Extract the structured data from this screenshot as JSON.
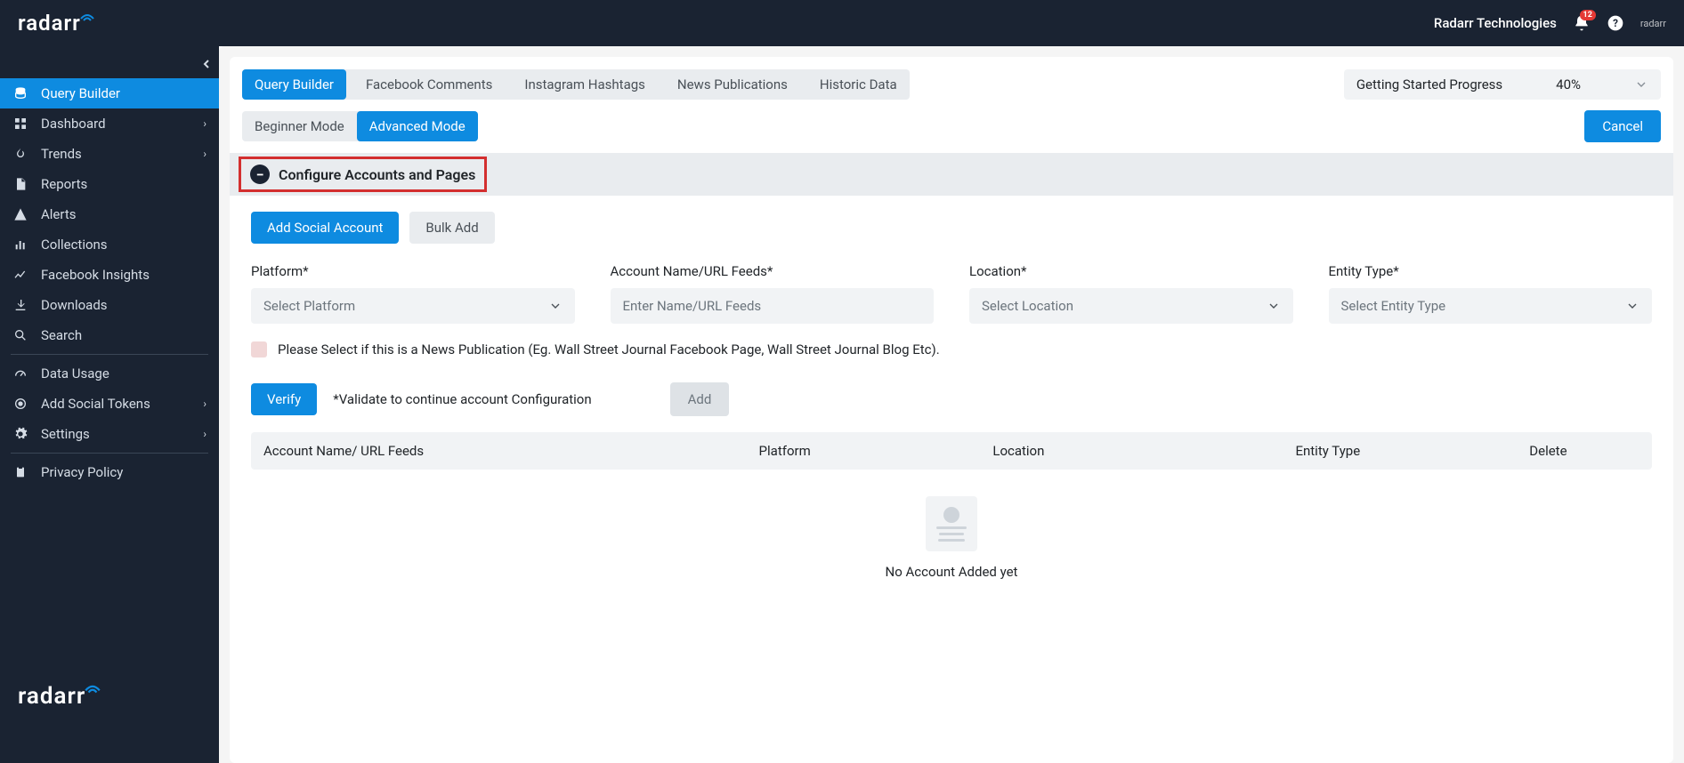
{
  "header": {
    "logo": "radarr",
    "company": "Radarr Technologies",
    "notifications": "12"
  },
  "sidebar": {
    "items": [
      {
        "label": "Query Builder",
        "icon": "db",
        "active": true
      },
      {
        "label": "Dashboard",
        "icon": "grid",
        "chevron": true
      },
      {
        "label": "Trends",
        "icon": "flame",
        "chevron": true
      },
      {
        "label": "Reports",
        "icon": "file"
      },
      {
        "label": "Alerts",
        "icon": "warn"
      },
      {
        "label": "Collections",
        "icon": "bars"
      },
      {
        "label": "Facebook Insights",
        "icon": "chart"
      },
      {
        "label": "Downloads",
        "icon": "download"
      },
      {
        "label": "Search",
        "icon": "search"
      },
      {
        "label": "Data Usage",
        "icon": "gauge",
        "divider_before": true
      },
      {
        "label": "Add Social Tokens",
        "icon": "target",
        "chevron": true
      },
      {
        "label": "Settings",
        "icon": "gear",
        "chevron": true
      },
      {
        "label": "Privacy Policy",
        "icon": "clip",
        "divider_before": true
      }
    ]
  },
  "tabs": {
    "main": [
      "Query Builder",
      "Facebook Comments",
      "Instagram Hashtags",
      "News Publications",
      "Historic Data"
    ],
    "mode": [
      "Beginner Mode",
      "Advanced Mode"
    ]
  },
  "progress": {
    "label": "Getting Started Progress",
    "value": "40%"
  },
  "buttons": {
    "cancel": "Cancel",
    "add_social": "Add Social Account",
    "bulk_add": "Bulk Add",
    "verify": "Verify",
    "add": "Add"
  },
  "section": {
    "title": "Configure Accounts and Pages"
  },
  "form": {
    "platform": {
      "label": "Platform*",
      "placeholder": "Select Platform"
    },
    "account": {
      "label": "Account Name/URL Feeds*",
      "placeholder": "Enter Name/URL Feeds"
    },
    "location": {
      "label": "Location*",
      "placeholder": "Select Location"
    },
    "entity": {
      "label": "Entity Type*",
      "placeholder": "Select Entity Type"
    },
    "checkbox_label": "Please Select if this is a News Publication (Eg. Wall Street Journal Facebook Page, Wall Street Journal Blog Etc).",
    "verify_note": "*Validate to continue account Configuration"
  },
  "table": {
    "headers": {
      "name": "Account Name/ URL Feeds",
      "platform": "Platform",
      "location": "Location",
      "entity": "Entity Type",
      "delete": "Delete"
    },
    "empty": "No Account Added yet"
  }
}
